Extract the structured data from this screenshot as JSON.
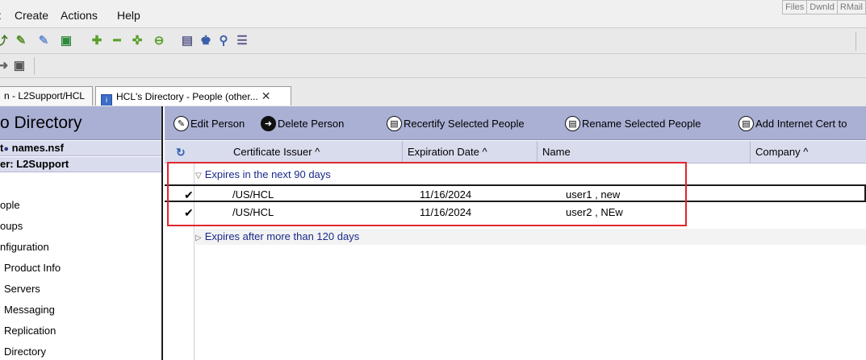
{
  "menu": {
    "left_glyph": ":",
    "items": [
      "Create",
      "Actions",
      "Help"
    ]
  },
  "right_tools": [
    "Files",
    "Dwnld",
    "RMail"
  ],
  "toolbar": {
    "icons": [
      "bookmark-arrow-icon",
      "person-add-icon",
      "person-edit-icon",
      "document-icon",
      "plus-icon",
      "minus-icon",
      "expand-icon",
      "collapse-icon",
      "calculator-icon",
      "binoculars-icon",
      "magnifier-icon",
      "page-icon"
    ]
  },
  "tabs": [
    {
      "label": "n - L2Support/HCL"
    },
    {
      "label": "HCL's Directory - People (other..."
    }
  ],
  "left_panel": {
    "title": "o Directory",
    "db_row": "t",
    "db_name": "names.nsf",
    "server_row": "er: L2Support",
    "nav": [
      "ople",
      "oups",
      "nfiguration",
      "Product Info",
      "Servers",
      "Messaging",
      "Replication",
      "Directory"
    ]
  },
  "actions": [
    {
      "label": "Edit Person"
    },
    {
      "label": "Delete Person"
    },
    {
      "label": "Recertify Selected People"
    },
    {
      "label": "Rename Selected People"
    },
    {
      "label": "Add Internet Cert to"
    }
  ],
  "columns": [
    {
      "label": "Certificate Issuer ^"
    },
    {
      "label": "Expiration Date ^"
    },
    {
      "label": "Name"
    },
    {
      "label": "Company ^"
    }
  ],
  "categories": [
    {
      "label": "Expires in the next 90 days",
      "expanded": true
    },
    {
      "label": "Expires after more than 120 days",
      "expanded": false
    }
  ],
  "rows": [
    {
      "issuer": "/US/HCL",
      "expiration": "11/16/2024",
      "name": "user1 , new",
      "company": "",
      "checked": true
    },
    {
      "issuer": "/US/HCL",
      "expiration": "11/16/2024",
      "name": "user2 , NEw",
      "company": "",
      "checked": true
    }
  ],
  "colors": {
    "panel_header": "#aab0d4",
    "panel_row": "#d9dced",
    "category_text": "#1a2a8a",
    "highlight": "#e0262d"
  }
}
